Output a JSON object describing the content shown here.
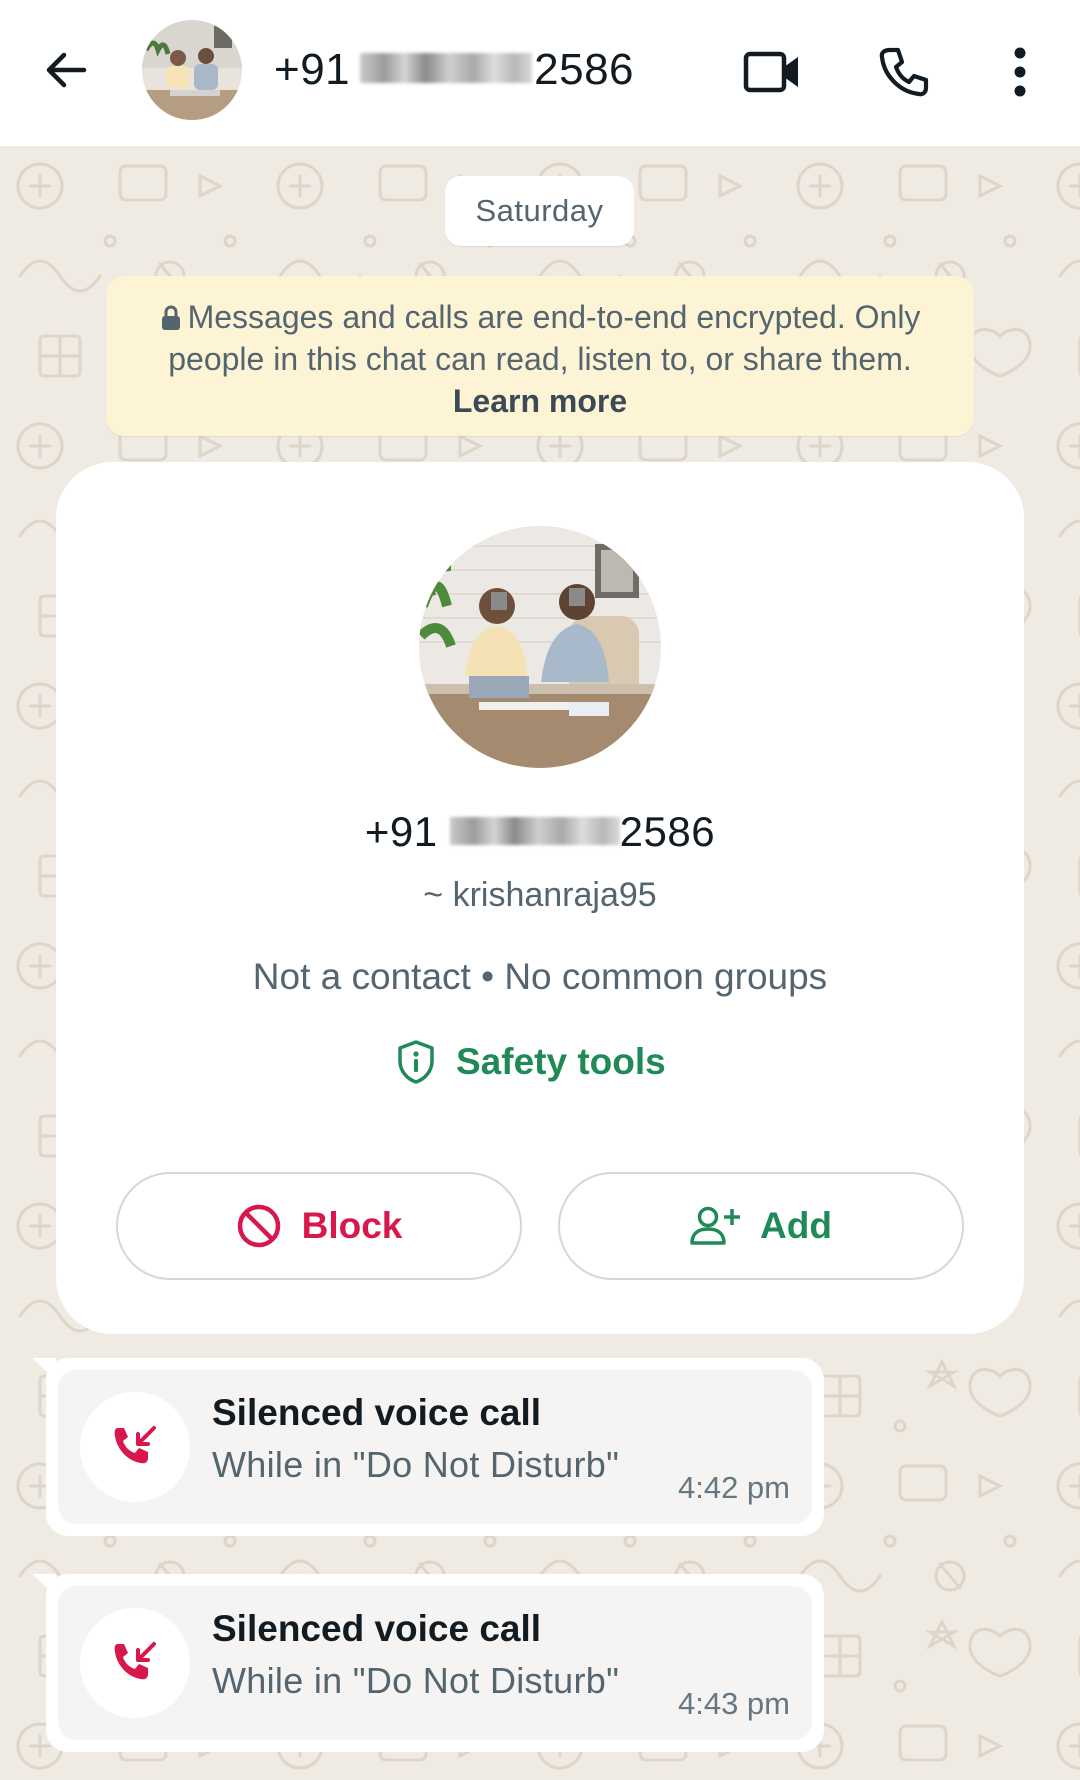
{
  "header": {
    "title_prefix": "+91",
    "title_suffix": "2586",
    "icons": {
      "back": "arrow-left-icon",
      "video": "video-camera-icon",
      "call": "phone-icon",
      "menu": "more-vertical-icon"
    }
  },
  "chat": {
    "date_label": "Saturday",
    "encryption_notice": {
      "text": "Messages and calls are end-to-end encrypted. Only people in this chat can read, listen to, or share them.",
      "link": "Learn more"
    },
    "contact_card": {
      "phone_prefix": "+91",
      "phone_suffix": "2586",
      "username": "~ krishanraja95",
      "meta": "Not a contact • No common groups",
      "safety_label": "Safety tools",
      "block_label": "Block",
      "add_label": "Add"
    },
    "calls": [
      {
        "title": "Silenced voice call",
        "subtitle": "While in \"Do Not Disturb\"",
        "time": "4:42 pm"
      },
      {
        "title": "Silenced voice call",
        "subtitle": "While in \"Do Not Disturb\"",
        "time": "4:43 pm"
      }
    ]
  },
  "colors": {
    "brand_green": "#1f8a56",
    "danger_red": "#d8184c",
    "notice_bg": "#fdf4d6",
    "chat_bg": "#efeae2"
  }
}
